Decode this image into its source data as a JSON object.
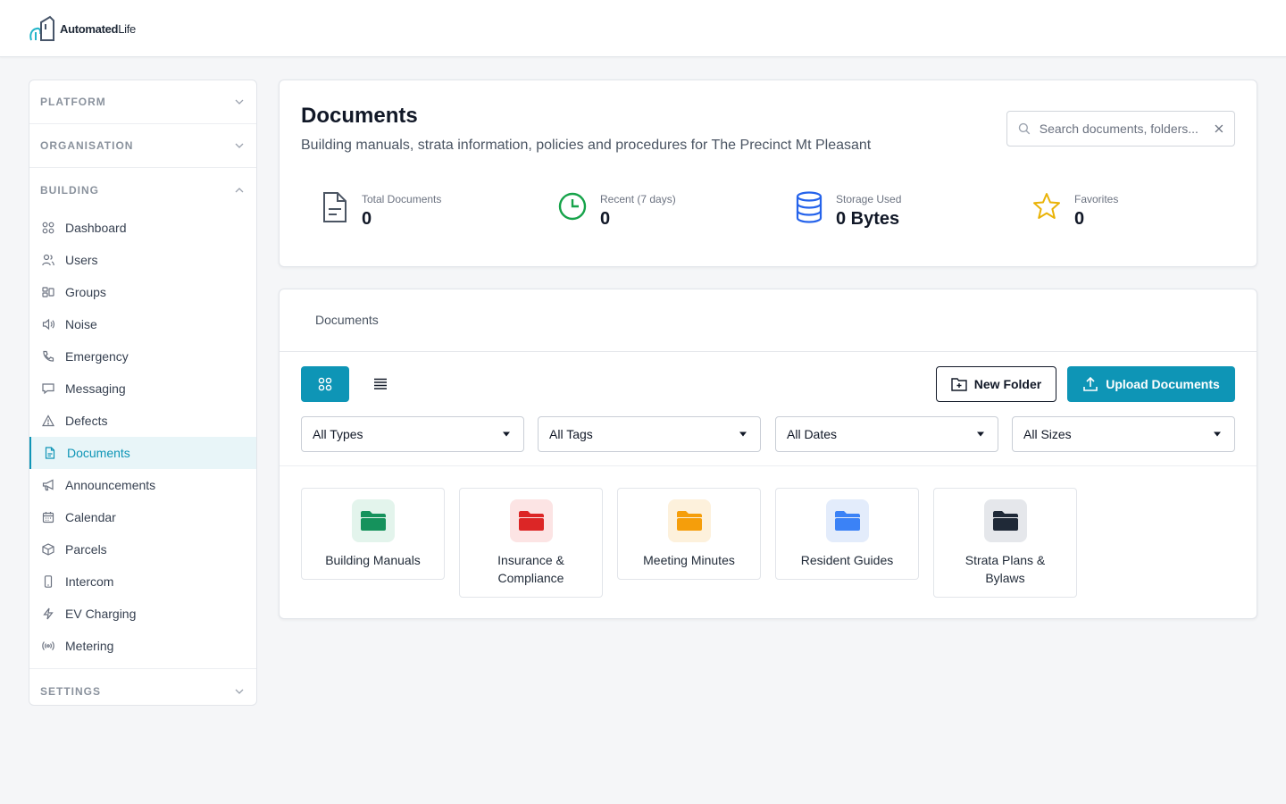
{
  "brand": {
    "name_bold": "Automated",
    "name_light": "Life"
  },
  "sidebar": {
    "sections": {
      "platform": "PLATFORM",
      "organisation": "ORGANISATION",
      "building": "BUILDING",
      "settings": "SETTINGS"
    },
    "items": [
      {
        "label": "Dashboard",
        "icon": "dashboard-icon"
      },
      {
        "label": "Users",
        "icon": "users-icon"
      },
      {
        "label": "Groups",
        "icon": "groups-icon"
      },
      {
        "label": "Noise",
        "icon": "speaker-icon"
      },
      {
        "label": "Emergency",
        "icon": "phone-icon"
      },
      {
        "label": "Messaging",
        "icon": "chat-icon"
      },
      {
        "label": "Defects",
        "icon": "warning-icon"
      },
      {
        "label": "Documents",
        "icon": "document-icon",
        "active": true
      },
      {
        "label": "Announcements",
        "icon": "megaphone-icon"
      },
      {
        "label": "Calendar",
        "icon": "calendar-icon"
      },
      {
        "label": "Parcels",
        "icon": "box-icon"
      },
      {
        "label": "Intercom",
        "icon": "mobile-icon"
      },
      {
        "label": "EV Charging",
        "icon": "lightning-icon"
      },
      {
        "label": "Metering",
        "icon": "signal-icon"
      }
    ]
  },
  "header": {
    "title": "Documents",
    "subtitle": "Building manuals, strata information, policies and procedures for The Precinct Mt Pleasant",
    "search_placeholder": "Search documents, folders..."
  },
  "stats": [
    {
      "label": "Total Documents",
      "value": "0",
      "icon": "file-icon",
      "color": "#4b5563"
    },
    {
      "label": "Recent (7 days)",
      "value": "0",
      "icon": "clock-icon",
      "color": "#16a34a"
    },
    {
      "label": "Storage Used",
      "value": "0 Bytes",
      "icon": "database-icon",
      "color": "#2563eb"
    },
    {
      "label": "Favorites",
      "value": "0",
      "icon": "star-icon",
      "color": "#eab308"
    }
  ],
  "documents": {
    "tab_label": "Documents",
    "new_folder_label": "New Folder",
    "upload_label": "Upload Documents",
    "filters": [
      "All Types",
      "All Tags",
      "All Dates",
      "All Sizes"
    ],
    "folders": [
      {
        "name": "Building Manuals",
        "color": "#15925c",
        "bg": "#e3f4ec"
      },
      {
        "name": "Insurance & Compliance",
        "color": "#dc2626",
        "bg": "#fce4e4"
      },
      {
        "name": "Meeting Minutes",
        "color": "#f59e0b",
        "bg": "#fdf1dc"
      },
      {
        "name": "Resident Guides",
        "color": "#3b82f6",
        "bg": "#e3ecfb"
      },
      {
        "name": "Strata Plans & Bylaws",
        "color": "#1f2937",
        "bg": "#e5e7eb"
      }
    ]
  },
  "colors": {
    "accent": "#0e95b6"
  }
}
